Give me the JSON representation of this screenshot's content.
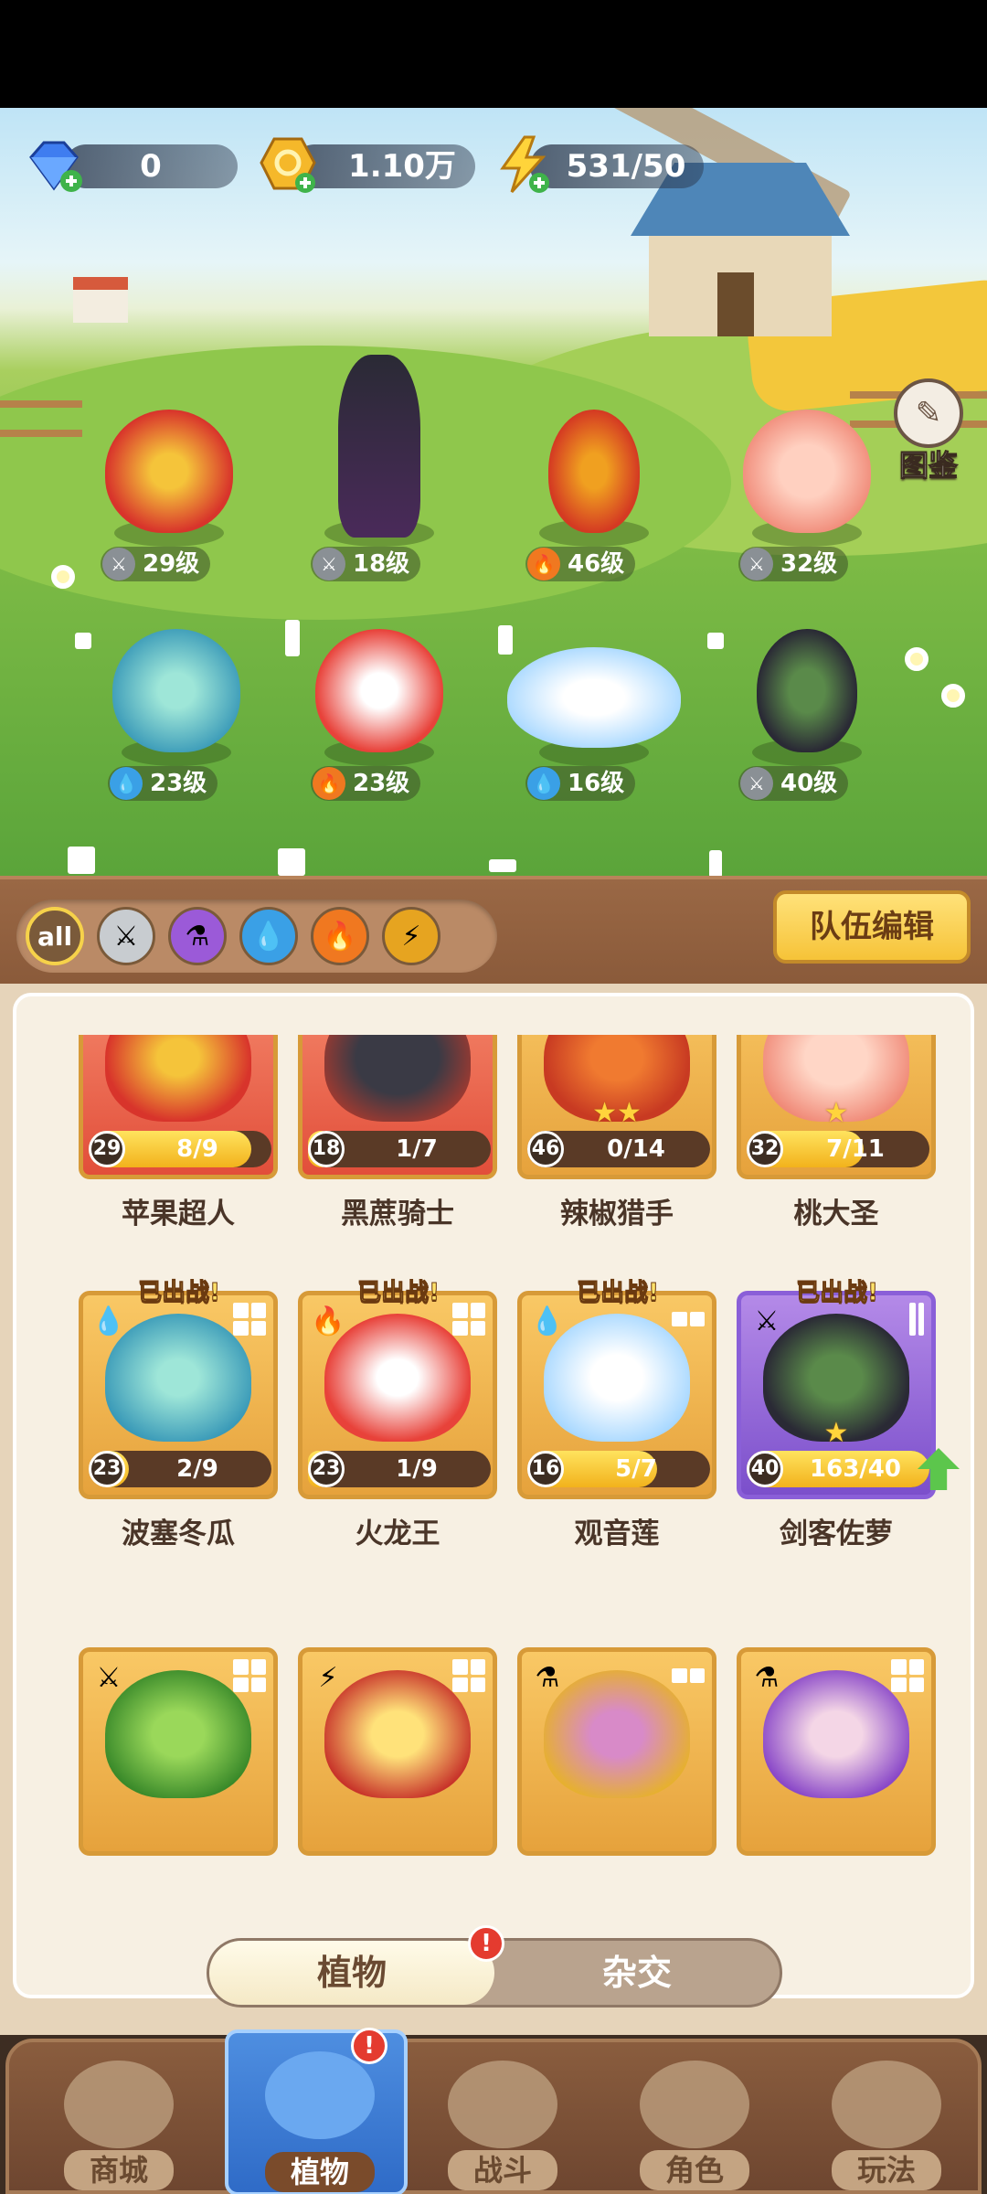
{
  "resources": {
    "gems": "0",
    "coins": "1.10万",
    "energy": "531/50"
  },
  "codex_label": "图鉴",
  "field_heroes": [
    {
      "level": "29级",
      "element": "sword"
    },
    {
      "level": "18级",
      "element": "sword"
    },
    {
      "level": "46级",
      "element": "fire"
    },
    {
      "level": "32级",
      "element": "sword"
    },
    {
      "level": "23级",
      "element": "water"
    },
    {
      "level": "23级",
      "element": "fire"
    },
    {
      "level": "16级",
      "element": "water"
    },
    {
      "level": "40级",
      "element": "sword"
    }
  ],
  "filters": [
    "all",
    "sword",
    "potion",
    "water",
    "fire",
    "lightning"
  ],
  "team_edit_label": "队伍编辑",
  "cards": [
    {
      "name": "苹果超人",
      "level": "29",
      "progress": "8/9",
      "ratio": 0.89,
      "theme": "red"
    },
    {
      "name": "黑蔗骑士",
      "level": "18",
      "progress": "1/7",
      "ratio": 0.14,
      "theme": "red"
    },
    {
      "name": "辣椒猎手",
      "level": "46",
      "progress": "0/14",
      "ratio": 0,
      "theme": "gold",
      "stars": "★★"
    },
    {
      "name": "桃大圣",
      "level": "32",
      "progress": "7/11",
      "ratio": 0.64,
      "theme": "gold",
      "stars": "★"
    },
    {
      "name": "波塞冬瓜",
      "level": "23",
      "progress": "2/9",
      "ratio": 0.22,
      "theme": "gold",
      "deployed": "已出战!"
    },
    {
      "name": "火龙王",
      "level": "23",
      "progress": "1/9",
      "ratio": 0.11,
      "theme": "gold",
      "deployed": "已出战!"
    },
    {
      "name": "观音莲",
      "level": "16",
      "progress": "5/7",
      "ratio": 0.71,
      "theme": "gold",
      "deployed": "已出战!"
    },
    {
      "name": "剑客佐萝",
      "level": "40",
      "progress": "163/40",
      "ratio": 1,
      "theme": "purple",
      "deployed": "已出战!",
      "stars": "★"
    }
  ],
  "toggle": {
    "active": "植物",
    "inactive": "杂交",
    "badge": "!"
  },
  "nav": [
    {
      "label": "商城"
    },
    {
      "label": "植物",
      "badge": "!"
    },
    {
      "label": "战斗"
    },
    {
      "label": "角色"
    },
    {
      "label": "玩法"
    }
  ],
  "colors": {
    "accent": "#f6c338",
    "nav_active": "#2f6bc7",
    "panel": "#f7f0e3"
  }
}
